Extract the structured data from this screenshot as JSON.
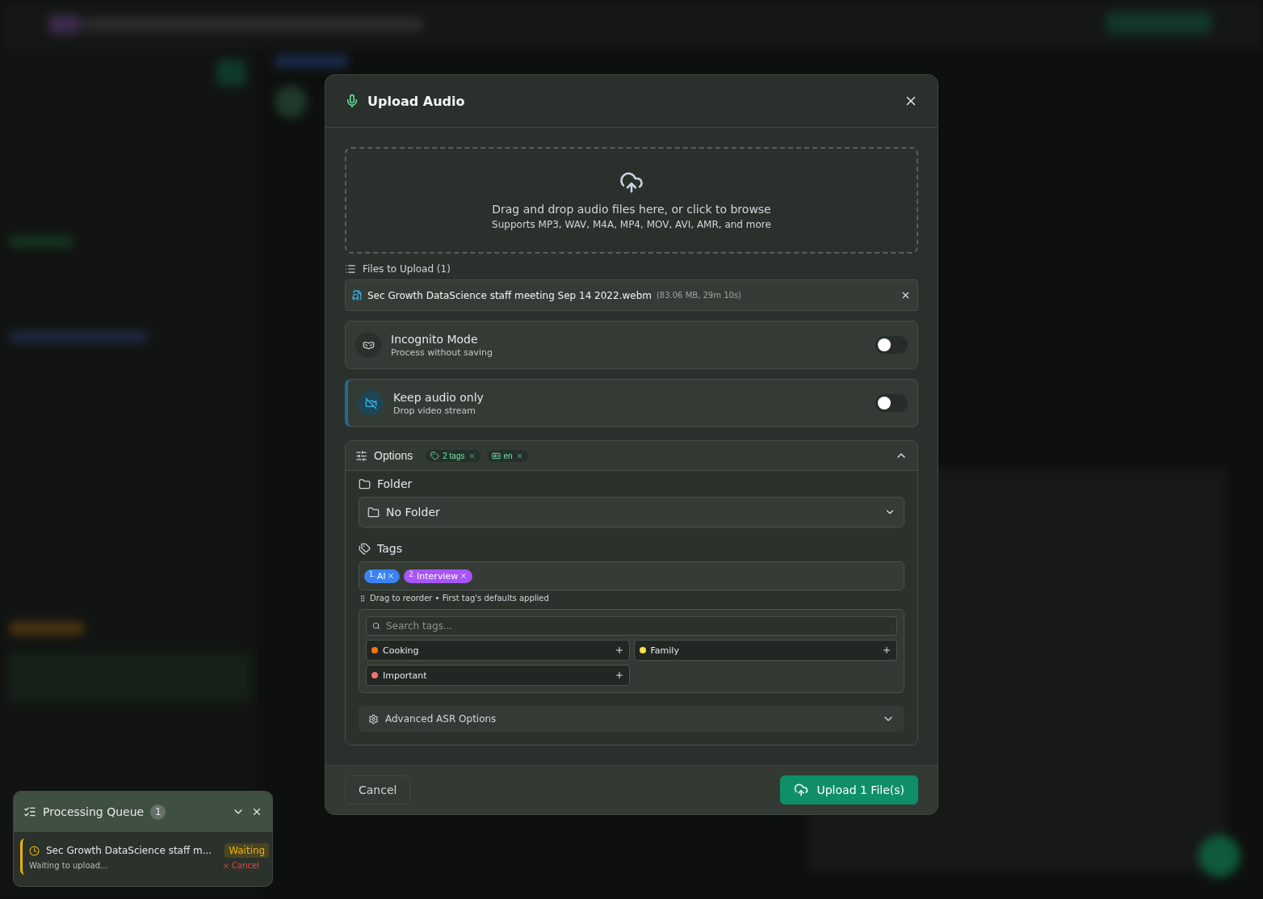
{
  "dialog": {
    "title": "Upload Audio",
    "dropzone": {
      "title": "Drag and drop audio files here, or click to browse",
      "subtitle": "Supports MP3, WAV, M4A, MP4, MOV, AVI, AMR, and more"
    },
    "files_heading": "Files to Upload (1)",
    "files": [
      {
        "name": "Sec Growth DataScience staff meeting Sep 14 2022.webm",
        "meta": "(83.06 MB, 29m 10s)"
      }
    ],
    "toggles": [
      {
        "kind": "incognito",
        "title": "Incognito Mode",
        "subtitle": "Process without saving",
        "on": false,
        "highlighted": false
      },
      {
        "kind": "video",
        "title": "Keep audio only",
        "subtitle": "Drop video stream",
        "on": false,
        "highlighted": true
      }
    ],
    "options": {
      "title": "Options",
      "expanded": true,
      "chips": [
        {
          "kind": "tag",
          "label": "2 tags"
        },
        {
          "kind": "language",
          "label": "en"
        }
      ],
      "folder_label": "Folder",
      "folder_value": "No Folder",
      "tags_label": "Tags",
      "selected_tags": [
        {
          "index": "1.",
          "label": "AI",
          "color": "#3b82f6"
        },
        {
          "index": "2.",
          "label": "Interview",
          "color": "#a855f7"
        }
      ],
      "hint": "Drag to reorder • First tag's defaults applied",
      "search_placeholder": "Search tags...",
      "available_tags": [
        {
          "label": "Cooking",
          "color": "#f97316"
        },
        {
          "label": "Family",
          "color": "#fde047"
        },
        {
          "label": "Important",
          "color": "#f87171"
        }
      ],
      "advanced": {
        "label": "Advanced ASR Options",
        "expanded": false
      }
    },
    "buttons": {
      "cancel": "Cancel",
      "upload": "Upload 1 File(s)"
    }
  },
  "queue": {
    "title": "Processing Queue",
    "count": "1",
    "expanded": true,
    "items": [
      {
        "name": "Sec Growth DataScience staff m...",
        "status": "Waiting",
        "detail": "Waiting to upload...",
        "action": "Cancel"
      }
    ]
  }
}
